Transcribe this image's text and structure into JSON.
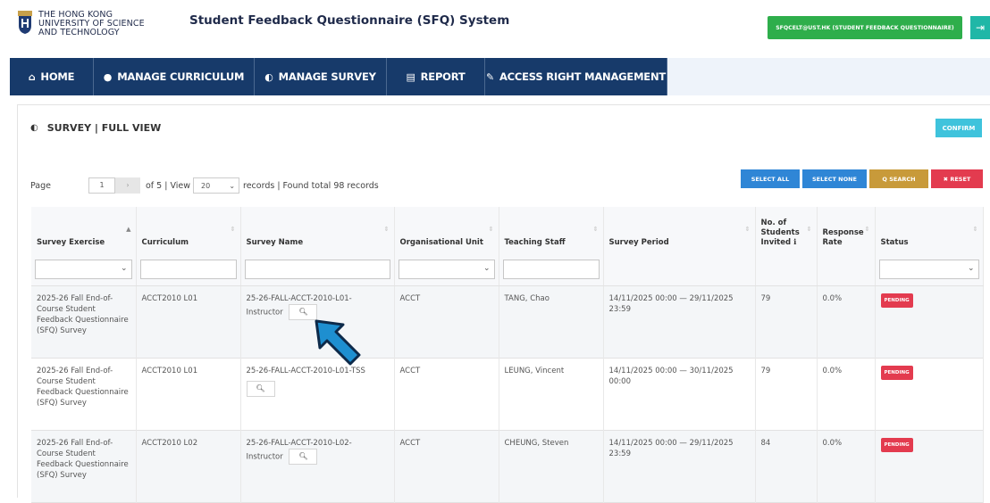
{
  "header": {
    "logo_lines": [
      "THE HONG KONG",
      "UNIVERSITY OF SCIENCE",
      "AND TECHNOLOGY"
    ],
    "app_title": "Student Feedback Questionnaire (SFQ) System",
    "user_label": "SFQCELT@UST.HK (STUDENT FEEDBACK QUESTIONNAIRE)",
    "logout_icon": "logout-icon"
  },
  "nav": [
    {
      "label": "HOME",
      "icon": "home-icon",
      "glyph": "⌂"
    },
    {
      "label": "MANAGE CURRICULUM",
      "icon": "comment-icon",
      "glyph": "●"
    },
    {
      "label": "MANAGE SURVEY",
      "icon": "eye-icon",
      "glyph": "◐"
    },
    {
      "label": "REPORT",
      "icon": "chart-icon",
      "glyph": "▤"
    },
    {
      "label": "ACCESS RIGHT MANAGEMENT",
      "icon": "pencil-icon",
      "glyph": "✎"
    }
  ],
  "panel": {
    "title": "SURVEY | FULL VIEW",
    "confirm_label": "CONFIRM"
  },
  "pager": {
    "page_label": "Page",
    "page_value": "1",
    "next_glyph": "›",
    "of_text": "of 5 | View",
    "view_value": "20",
    "records_text": "records | Found total 98 records"
  },
  "actions": {
    "select_all": "SELECT ALL",
    "select_none": "SELECT NONE",
    "search": "Q SEARCH",
    "reset": "✖ RESET"
  },
  "colors": {
    "nav_bg": "#173a6a",
    "select_all_bg": "#2f86d6",
    "select_none_bg": "#2f86d6",
    "search_bg": "#c89a3a",
    "reset_bg": "#e33b4f",
    "pending_bg": "#e33b4f",
    "user_bg": "#2eae4b"
  },
  "table": {
    "columns": [
      "Survey Exercise",
      "Curriculum",
      "Survey Name",
      "Organisational Unit",
      "Teaching Staff",
      "Survey Period",
      "No. of Students Invited",
      "Response Rate",
      "Status"
    ],
    "info_glyph": "ℹ",
    "rows": [
      {
        "exercise": "2025-26 Fall End-of-Course Student Feedback Questionnaire (SFQ) Survey",
        "curriculum": "ACCT2010 L01",
        "survey_name": "25-26-FALL-ACCT-2010-L01-Instructor",
        "unit": "ACCT",
        "staff": "TANG, Chao",
        "period": "14/11/2025 00:00 — 29/11/2025 23:59",
        "invited": "79",
        "rate": "0.0%",
        "status": "PENDING"
      },
      {
        "exercise": "2025-26 Fall End-of-Course Student Feedback Questionnaire (SFQ) Survey",
        "curriculum": "ACCT2010 L01",
        "survey_name": "25-26-FALL-ACCT-2010-L01-TSS",
        "unit": "ACCT",
        "staff": "LEUNG, Vincent",
        "period": "14/11/2025 00:00 — 30/11/2025 00:00",
        "invited": "79",
        "rate": "0.0%",
        "status": "PENDING"
      },
      {
        "exercise": "2025-26 Fall End-of-Course Student Feedback Questionnaire (SFQ) Survey",
        "curriculum": "ACCT2010 L02",
        "survey_name": "25-26-FALL-ACCT-2010-L02-Instructor",
        "unit": "ACCT",
        "staff": "CHEUNG, Steven",
        "period": "14/11/2025 00:00 — 29/11/2025 23:59",
        "invited": "84",
        "rate": "0.0%",
        "status": "PENDING"
      }
    ]
  }
}
